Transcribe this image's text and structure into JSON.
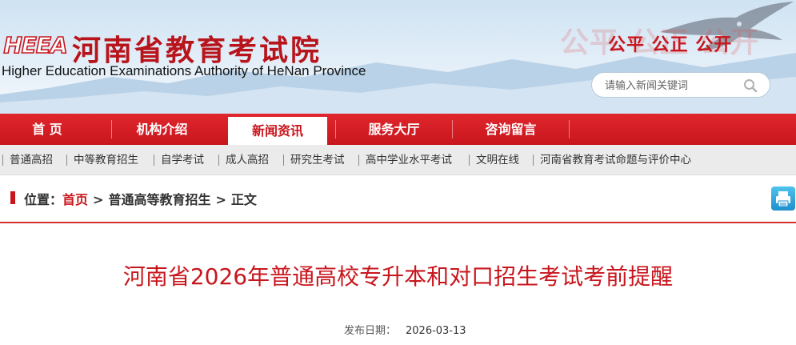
{
  "header": {
    "logo_text": "HEEA",
    "title": "河南省教育考试院",
    "subtitle": "Higher Education Examinations Authority of HeNan Province",
    "slogan": "公平 公正 公开",
    "slogan_ghost": "公平 公正 公开",
    "search": {
      "placeholder": "请输入新闻关键词",
      "icon": "search-icon"
    }
  },
  "nav": {
    "items": [
      {
        "label": "首 页"
      },
      {
        "label": "机构介绍"
      },
      {
        "label": "新闻资讯",
        "active": true
      },
      {
        "label": "服务大厅"
      },
      {
        "label": "咨询留言"
      }
    ]
  },
  "subnav": {
    "items": [
      {
        "label": "普通高招"
      },
      {
        "label": "中等教育招生"
      },
      {
        "label": "自学考试"
      },
      {
        "label": "成人高招"
      },
      {
        "label": "研究生考试"
      },
      {
        "label": "高中学业水平考试"
      },
      {
        "label": "文明在线"
      },
      {
        "label": "河南省教育考试命题与评价中心"
      }
    ]
  },
  "breadcrumb": {
    "prefix": "位置：",
    "home": "首页",
    "separator": ">",
    "section": "普通高等教育招生",
    "current": "正文",
    "print_icon": "print-icon"
  },
  "article": {
    "title": "河南省2026年普通高校专升本和对口招生考试考前提醒",
    "date_label": "发布日期：",
    "date_value": "2026-03-13"
  },
  "colors": {
    "brand_red": "#c8161d",
    "nav_red": "#e0262d",
    "subnav_bg": "#ebebeb",
    "header_sky": "#cfe3f3"
  }
}
